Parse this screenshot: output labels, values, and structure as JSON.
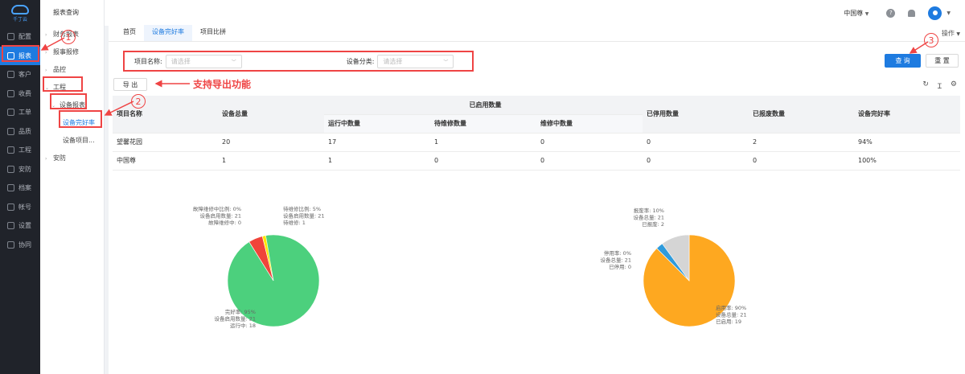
{
  "leftbar": {
    "logo_text": "千丁云",
    "items": [
      {
        "label": "配置",
        "icon": "gear-icon"
      },
      {
        "label": "报表",
        "icon": "report-icon",
        "active": true
      },
      {
        "label": "客户",
        "icon": "user-icon"
      },
      {
        "label": "收费",
        "icon": "fee-icon"
      },
      {
        "label": "工单",
        "icon": "ticket-icon"
      },
      {
        "label": "品质",
        "icon": "quality-icon"
      },
      {
        "label": "工程",
        "icon": "engineering-icon"
      },
      {
        "label": "安防",
        "icon": "shield-icon"
      },
      {
        "label": "档案",
        "icon": "archive-icon"
      },
      {
        "label": "帐号",
        "icon": "account-icon"
      },
      {
        "label": "设置",
        "icon": "settings-icon"
      },
      {
        "label": "协同",
        "icon": "collab-icon"
      }
    ]
  },
  "subnav": {
    "title": "报表查询",
    "items": [
      {
        "label": "财务报表",
        "level": 0
      },
      {
        "label": "报事报修",
        "level": 0
      },
      {
        "label": "品控",
        "level": 0
      },
      {
        "label": "工程",
        "level": 0
      },
      {
        "label": "设备报表",
        "level": 1
      },
      {
        "label": "设备完好率",
        "level": 2
      },
      {
        "label": "设备项目...",
        "level": 2
      },
      {
        "label": "安防",
        "level": 0
      }
    ]
  },
  "topbar": {
    "project": "中国尊",
    "help_icon": "?"
  },
  "tabs": [
    {
      "label": "首页"
    },
    {
      "label": "设备完好率",
      "active": true
    },
    {
      "label": "项目比拼"
    }
  ],
  "ops_label": "操作",
  "filter": {
    "project_label": "项目名称:",
    "project_placeholder": "请选择",
    "category_label": "设备分类:",
    "category_placeholder": "请选择"
  },
  "buttons": {
    "query": "查 询",
    "reset": "重 置",
    "export": "导 出"
  },
  "table": {
    "headers": {
      "project": "项目名称",
      "total": "设备总量",
      "enabled_group": "已启用数量",
      "running": "运行中数量",
      "pending": "待维修数量",
      "repairing": "维修中数量",
      "disabled": "已停用数量",
      "scrapped": "已报废数量",
      "rate": "设备完好率"
    },
    "rows": [
      [
        "望馨花园",
        "20",
        "17",
        "1",
        "0",
        "0",
        "2",
        "94%"
      ],
      [
        "中国尊",
        "1",
        "1",
        "0",
        "0",
        "0",
        "0",
        "100%"
      ]
    ]
  },
  "annotations": {
    "export_note": "支持导出功能",
    "circle1": "1",
    "circle2": "2",
    "circle3": "3"
  },
  "chart_data": [
    {
      "type": "pie",
      "slices": [
        {
          "name": "完好率",
          "value": 95,
          "color": "#4cd07d",
          "lines": [
            "完好率: 95%",
            "设备启用数量: 21",
            "运行中: 18"
          ]
        },
        {
          "name": "待维修比例",
          "value": 5,
          "color": "#ffe600",
          "lines": [
            "待维修比例: 5%",
            "设备启用数量: 21",
            "待维修: 1"
          ]
        },
        {
          "name": "故障维修中比例",
          "value": 0,
          "color": "#f0443a",
          "lines": [
            "故障维修中比例: 0%",
            "设备启用数量: 21",
            "故障维修中: 0"
          ]
        }
      ]
    },
    {
      "type": "pie",
      "slices": [
        {
          "name": "启用率",
          "value": 90,
          "color": "#fea820",
          "lines": [
            "启用率: 90%",
            "设备总量: 21",
            "已启用: 19"
          ]
        },
        {
          "name": "停用率",
          "value": 0,
          "color": "#2f9bdb",
          "lines": [
            "停用率: 0%",
            "设备总量: 21",
            "已停用: 0"
          ]
        },
        {
          "name": "报废率",
          "value": 10,
          "color": "#d5d5d5",
          "lines": [
            "报废率: 10%",
            "设备总量: 21",
            "已报废: 2"
          ]
        }
      ]
    }
  ]
}
